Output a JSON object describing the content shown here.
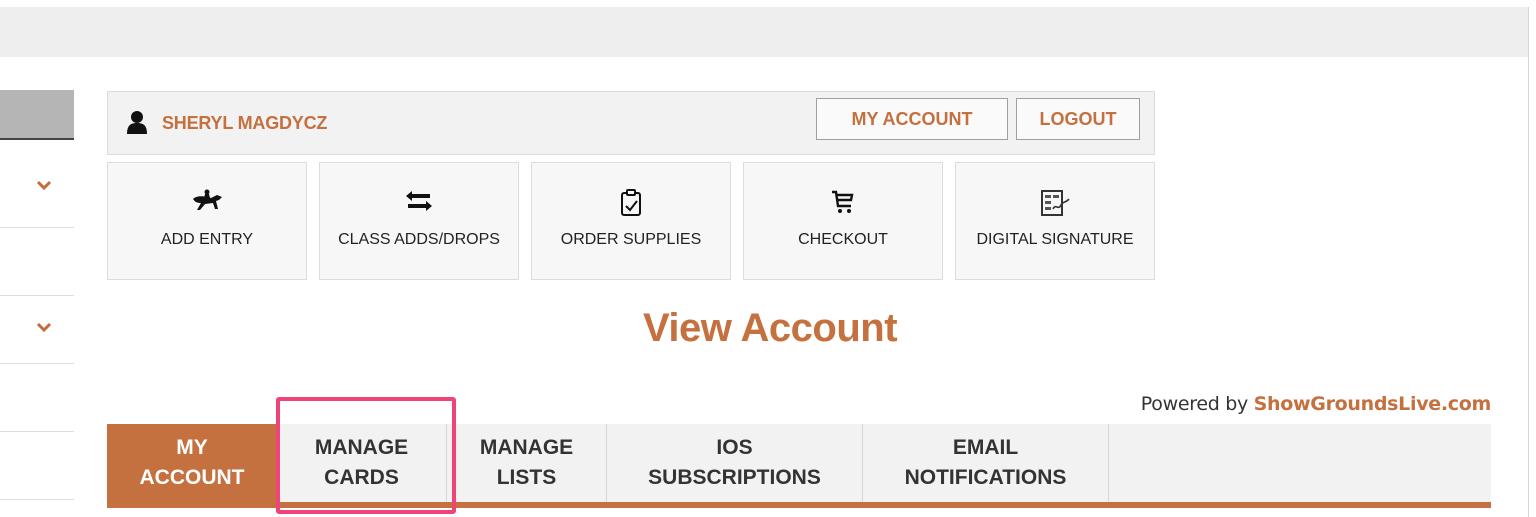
{
  "user": {
    "name": "SHERYL MAGDYCZ"
  },
  "header_buttons": {
    "my_account": "MY ACCOUNT",
    "logout": "LOGOUT"
  },
  "tiles": [
    {
      "label": "ADD ENTRY",
      "icon": "horse-rider-icon"
    },
    {
      "label": "CLASS ADDS/DROPS",
      "icon": "swap-arrows-icon"
    },
    {
      "label": "ORDER SUPPLIES",
      "icon": "clipboard-check-icon"
    },
    {
      "label": "CHECKOUT",
      "icon": "cart-icon"
    },
    {
      "label": "DIGITAL SIGNATURE",
      "icon": "signature-form-icon"
    }
  ],
  "page_title": "View Account",
  "powered_by": {
    "prefix": "Powered by ",
    "brand": "ShowGroundsLive.com"
  },
  "tabs": [
    {
      "line1": "MY",
      "line2": "ACCOUNT",
      "active": true
    },
    {
      "line1": "MANAGE",
      "line2": "CARDS",
      "active": false
    },
    {
      "line1": "MANAGE",
      "line2": "LISTS",
      "active": false
    },
    {
      "line1": "IOS",
      "line2": "SUBSCRIPTIONS",
      "active": false
    },
    {
      "line1": "EMAIL",
      "line2": "NOTIFICATIONS",
      "active": false
    }
  ],
  "colors": {
    "accent": "#c4703f",
    "highlight": "#ee4477",
    "bar": "#eeeeee"
  }
}
